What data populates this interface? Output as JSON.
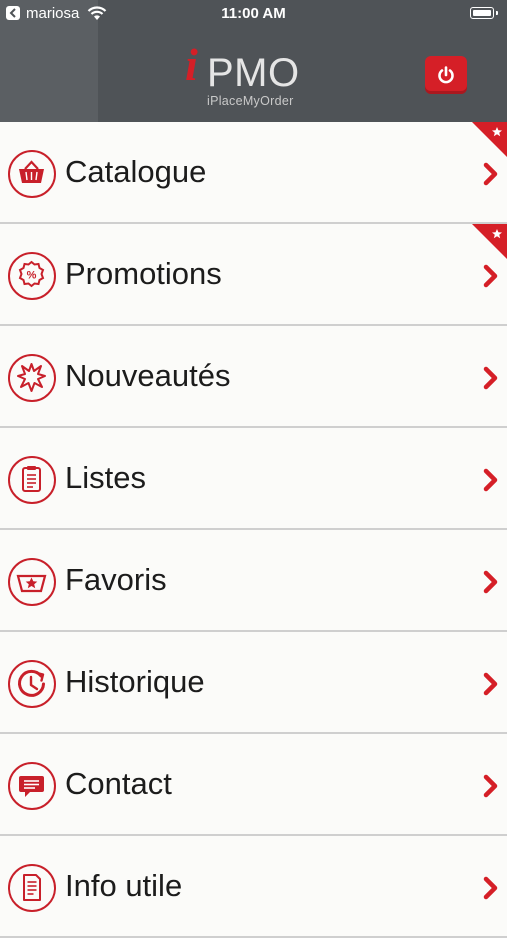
{
  "status_bar": {
    "carrier": "mariosa",
    "time": "11:00 AM"
  },
  "logo": {
    "letter_i": "i",
    "pmo": "PMO",
    "tagline": "iPlaceMyOrder"
  },
  "colors": {
    "accent": "#d51f27",
    "header_bg": "#4f5357",
    "row_bg": "#fbfbf9"
  },
  "menu": {
    "items": [
      {
        "label": "Catalogue",
        "icon": "basket-icon",
        "flag": true
      },
      {
        "label": "Promotions",
        "icon": "percent-badge-icon",
        "flag": true
      },
      {
        "label": "Nouveautés",
        "icon": "burst-icon",
        "flag": false
      },
      {
        "label": "Listes",
        "icon": "clipboard-icon",
        "flag": false
      },
      {
        "label": "Favoris",
        "icon": "basket-star-icon",
        "flag": false
      },
      {
        "label": "Historique",
        "icon": "history-clock-icon",
        "flag": false
      },
      {
        "label": "Contact",
        "icon": "speech-bubble-icon",
        "flag": false
      },
      {
        "label": "Info utile",
        "icon": "document-icon",
        "flag": false
      }
    ]
  }
}
